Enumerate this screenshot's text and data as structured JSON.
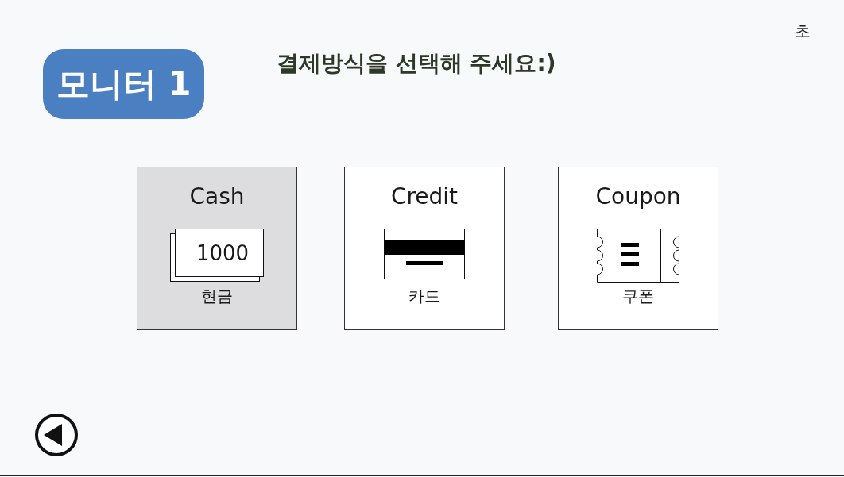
{
  "timer": {
    "label": "초"
  },
  "monitor_badge": {
    "label": "모니터 1"
  },
  "heading": "결제방식을 선택해 주세요:)",
  "payment_options": [
    {
      "kind": "cash",
      "title": "Cash",
      "banknote": "1000",
      "label": "현금",
      "selected": true
    },
    {
      "kind": "card",
      "title": "Credit",
      "label": "카드",
      "selected": false
    },
    {
      "kind": "coupon",
      "title": "Coupon",
      "label": "쿠폰",
      "selected": false
    }
  ]
}
